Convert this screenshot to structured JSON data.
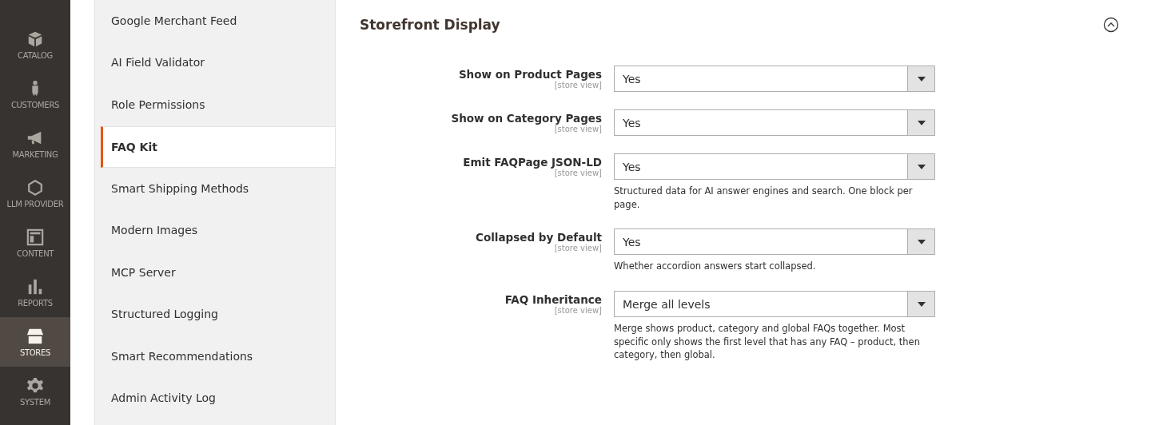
{
  "nav": [
    {
      "kind": "catalog",
      "label": "CATALOG",
      "selected": false
    },
    {
      "kind": "customers",
      "label": "CUSTOMERS",
      "selected": false
    },
    {
      "kind": "marketing",
      "label": "MARKETING",
      "selected": false
    },
    {
      "kind": "llm",
      "label": "LLM PROVIDER",
      "selected": false
    },
    {
      "kind": "content",
      "label": "CONTENT",
      "selected": false
    },
    {
      "kind": "reports",
      "label": "REPORTS",
      "selected": false
    },
    {
      "kind": "stores",
      "label": "STORES",
      "selected": true
    },
    {
      "kind": "system",
      "label": "SYSTEM",
      "selected": false
    }
  ],
  "sections": [
    {
      "label": "Google Merchant Feed",
      "selected": false
    },
    {
      "label": "AI Field Validator",
      "selected": false
    },
    {
      "label": "Role Permissions",
      "selected": false
    },
    {
      "label": "FAQ Kit",
      "selected": true
    },
    {
      "label": "Smart Shipping Methods",
      "selected": false
    },
    {
      "label": "Modern Images",
      "selected": false
    },
    {
      "label": "MCP Server",
      "selected": false
    },
    {
      "label": "Structured Logging",
      "selected": false
    },
    {
      "label": "Smart Recommendations",
      "selected": false
    },
    {
      "label": "Admin Activity Log",
      "selected": false
    }
  ],
  "group": {
    "title": "Storefront Display",
    "expanded": true,
    "fields": [
      {
        "label": "Show on Product Pages",
        "scope": "[store view]",
        "value": "Yes"
      },
      {
        "label": "Show on Category Pages",
        "scope": "[store view]",
        "value": "Yes"
      },
      {
        "label": "Emit FAQPage JSON-LD",
        "scope": "[store view]",
        "value": "Yes",
        "note": "Structured data for AI answer engines and search. One block per page."
      },
      {
        "label": "Collapsed by Default",
        "scope": "[store view]",
        "value": "Yes",
        "note": "Whether accordion answers start collapsed."
      },
      {
        "label": "FAQ Inheritance",
        "scope": "[store view]",
        "value": "Merge all levels",
        "note": "Merge shows product, category and global FAQs together. Most specific only shows the first level that has any FAQ – product, then category, then global."
      }
    ]
  }
}
